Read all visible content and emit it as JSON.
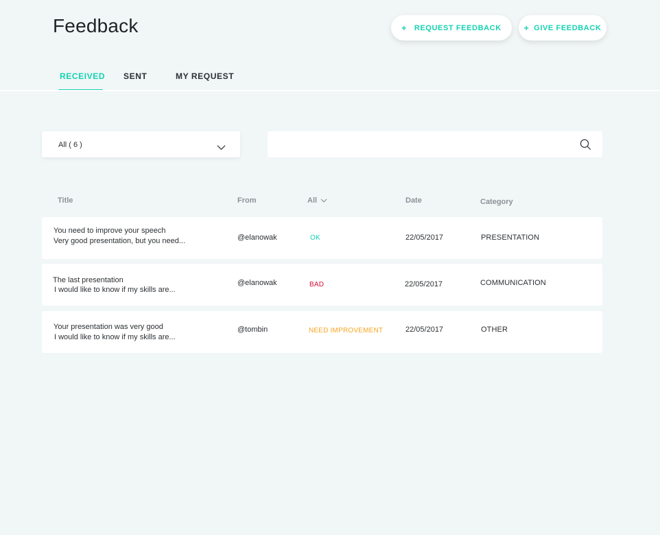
{
  "header": {
    "title": "Feedback",
    "request_button": {
      "icon": "+",
      "label": "REQUEST FEEDBACK"
    },
    "give_button": {
      "icon": "+",
      "label": "GIVE FEEDBACK"
    }
  },
  "tabs": [
    {
      "label": "RECEIVED",
      "active": true
    },
    {
      "label": "SENT",
      "active": false
    },
    {
      "label": "MY REQUEST",
      "active": false
    }
  ],
  "filter": {
    "selected": "All ( 6 )",
    "icon": "chevron-down-icon"
  },
  "search": {
    "value": "",
    "placeholder": "",
    "icon": "search-icon"
  },
  "table": {
    "columns": {
      "title": "Title",
      "from": "From",
      "status": "All",
      "date": "Date",
      "category": "Category"
    },
    "rows": [
      {
        "title": "You need to improve your speech",
        "excerpt": "Very good presentation, but you need...",
        "from": "@elanowak",
        "status": "OK",
        "date": "22/05/2017",
        "category": "PRESENTATION"
      },
      {
        "title": "The last presentation",
        "excerpt": "I would like to know if my skills are...",
        "from": "@elanowak",
        "status": "BAD",
        "date": "22/05/2017",
        "category": "COMMUNICATION"
      },
      {
        "title": "Your presentation was very good",
        "excerpt": "I would like to know if my skills are...",
        "from": "@tombin",
        "status": "NEED IMPROVEMENT",
        "date": "22/05/2017",
        "category": "OTHER"
      }
    ]
  },
  "colors": {
    "accent": "#14d3b2",
    "status_ok": "#14d3b2",
    "status_bad": "#d0103a",
    "status_need_improvement": "#f5a623",
    "background": "#f1f6f6"
  }
}
